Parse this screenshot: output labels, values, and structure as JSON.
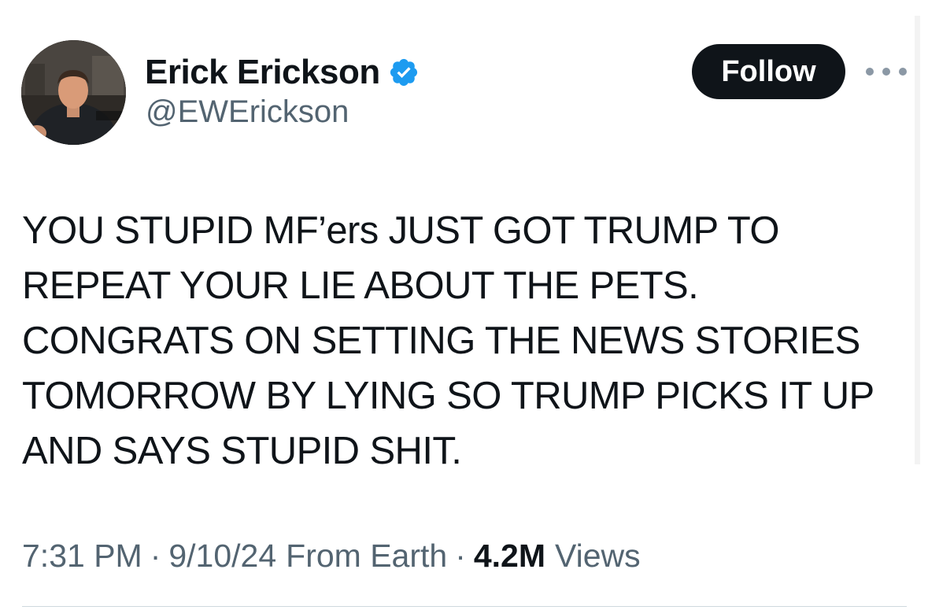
{
  "author": {
    "display_name": "Erick Erickson",
    "handle": "@EWErickson",
    "verified_icon": "verified-badge-icon",
    "avatar_icon": "profile-photo"
  },
  "actions": {
    "follow_label": "Follow",
    "more_icon": "more-horizontal-icon"
  },
  "tweet": {
    "lines": [
      "YOU STUPID MF’ers JUST GOT TRUMP TO",
      "REPEAT YOUR LIE ABOUT THE PETS.",
      "CONGRATS ON SETTING THE NEWS STORIES",
      "TOMORROW BY LYING SO TRUMP PICKS IT UP",
      "AND SAYS STUPID SHIT."
    ]
  },
  "meta": {
    "time": "7:31 PM",
    "separator": "·",
    "date": "9/10/24",
    "location": "From Earth",
    "views_count": "4.2M",
    "views_label": "Views"
  },
  "colors": {
    "text": "#0f1419",
    "secondary": "#536471",
    "verified": "#1d9bf0",
    "follow_bg": "#0f1419"
  }
}
